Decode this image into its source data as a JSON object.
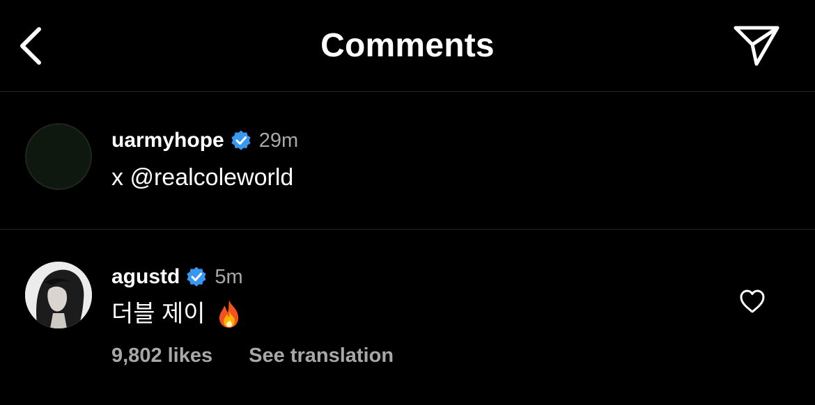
{
  "header": {
    "title": "Comments",
    "back_icon": "chevron-left-icon",
    "share_icon": "paper-plane-icon"
  },
  "colors": {
    "background": "#000000",
    "text_primary": "#ffffff",
    "text_secondary": "#a8a8a8",
    "divider": "#262626",
    "verified_badge": "#3897f0"
  },
  "comments": [
    {
      "username": "uarmyhope",
      "verified": true,
      "time": "29m",
      "text": "x @realcoleworld"
    },
    {
      "username": "agustd",
      "verified": true,
      "time": "5m",
      "text": "더블 제이",
      "emoji": "fire-icon",
      "likes": "9,802 likes",
      "translate_label": "See translation",
      "like_icon": "heart-outline-icon"
    }
  ]
}
